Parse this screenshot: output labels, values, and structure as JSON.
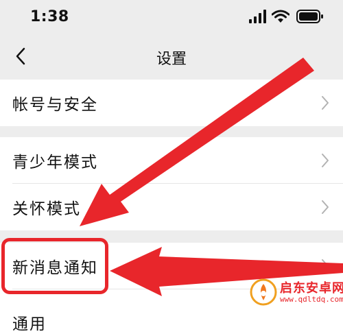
{
  "status_bar": {
    "time": "1:38",
    "icons": [
      "signal-icon",
      "wifi-icon",
      "battery-icon"
    ]
  },
  "nav": {
    "title": "设置",
    "back_icon": "chevron-left-icon"
  },
  "groups": [
    {
      "items": [
        {
          "label": "帐号与安全"
        }
      ]
    },
    {
      "items": [
        {
          "label": "青少年模式"
        },
        {
          "label": "关怀模式"
        }
      ]
    },
    {
      "items": [
        {
          "label": "新消息通知"
        },
        {
          "label": "通用"
        }
      ]
    }
  ],
  "annotation": {
    "color": "#e8262b",
    "highlighted_item": "新消息通知"
  },
  "watermark": {
    "name": "启东安卓网",
    "url": "www.qdltdq.com"
  },
  "colors": {
    "background": "#ededed",
    "row_background": "#ffffff",
    "accent_red": "#e8262b",
    "chevron": "#b2b2b2"
  }
}
